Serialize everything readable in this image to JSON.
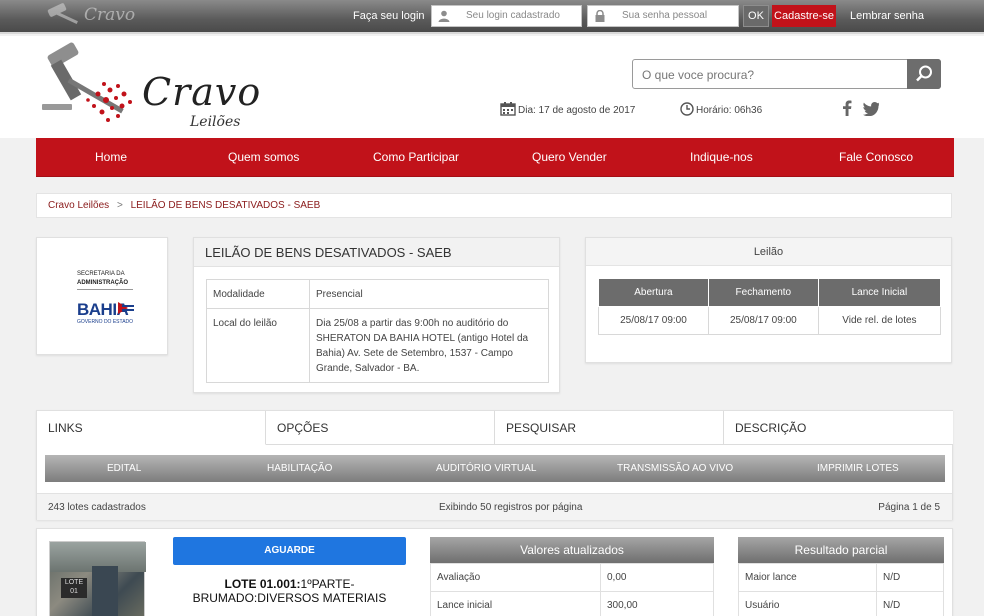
{
  "topbar": {
    "logo_text": "Cravo",
    "login_label": "Faça seu login",
    "login_placeholder": "Seu login cadastrado",
    "password_placeholder": "Sua senha pessoal",
    "ok_label": "OK",
    "register_label": "Cadastre-se",
    "remember_label": "Lembrar senha"
  },
  "header": {
    "logo_main": "Cravo",
    "logo_sub": "Leilões",
    "search_placeholder": "O que voce procura?",
    "date": "Dia: 17 de agosto de 2017",
    "time": "Horário: 06h36"
  },
  "nav": [
    "Home",
    "Quem somos",
    "Como Participar",
    "Quero Vender",
    "Indique-nos",
    "Fale Conosco"
  ],
  "breadcrumb": {
    "root": "Cravo Leilões",
    "separator": ">",
    "current": "LEILÃO DE BENS DESATIVADOS - SAEB"
  },
  "agency": {
    "line1": "SECRETARIA DA",
    "line2": "ADMINISTRAÇÃO",
    "brand": "BAHIA",
    "sub": "GOVERNO DO ESTADO"
  },
  "auction_info": {
    "title": "LEILÃO DE BENS DESATIVADOS - SAEB",
    "rows": [
      {
        "key": "Modalidade",
        "value": "Presencial"
      },
      {
        "key": "Local do leilão",
        "value": "Dia 25/08 a partir das 9:00h no auditório do SHERATON DA BAHIA HOTEL (antigo Hotel da Bahia) Av. Sete de Setembro, 1537 - Campo Grande, Salvador - BA."
      }
    ]
  },
  "leilao": {
    "title": "Leilão",
    "headers": [
      "Abertura",
      "Fechamento",
      "Lance Inicial"
    ],
    "values": [
      "25/08/17 09:00",
      "25/08/17 09:00",
      "Vide rel. de lotes"
    ]
  },
  "tabs": [
    "LINKS",
    "OPÇÕES",
    "PESQUISAR",
    "DESCRIÇÃO"
  ],
  "links": [
    "EDITAL",
    "HABILITAÇÃO",
    "AUDITÓRIO VIRTUAL",
    "TRANSMISSÃO AO VIVO",
    "IMPRIMIR LOTES"
  ],
  "listing": {
    "count": "243 lotes cadastrados",
    "per_page": "Exibindo 50 registros por página",
    "page": "Página 1 de 5"
  },
  "lot": {
    "image_tag": "LOTE 01",
    "status_button": "AGUARDE",
    "title_bold": "LOTE 01.001:",
    "title_rest": "1ºPARTE-BRUMADO:DIVERSOS MATERIAIS",
    "values_header": "Valores atualizados",
    "values": [
      {
        "key": "Avaliação",
        "value": "0,00"
      },
      {
        "key": "Lance inicial",
        "value": "300,00"
      }
    ],
    "result_header": "Resultado parcial",
    "results": [
      {
        "key": "Maior lance",
        "value": "N/D"
      },
      {
        "key": "Usuário",
        "value": "N/D"
      }
    ]
  },
  "colors": {
    "brand_red": "#c1121a",
    "button_blue": "#1f76e0",
    "gray_header": "#6c6c6c"
  }
}
